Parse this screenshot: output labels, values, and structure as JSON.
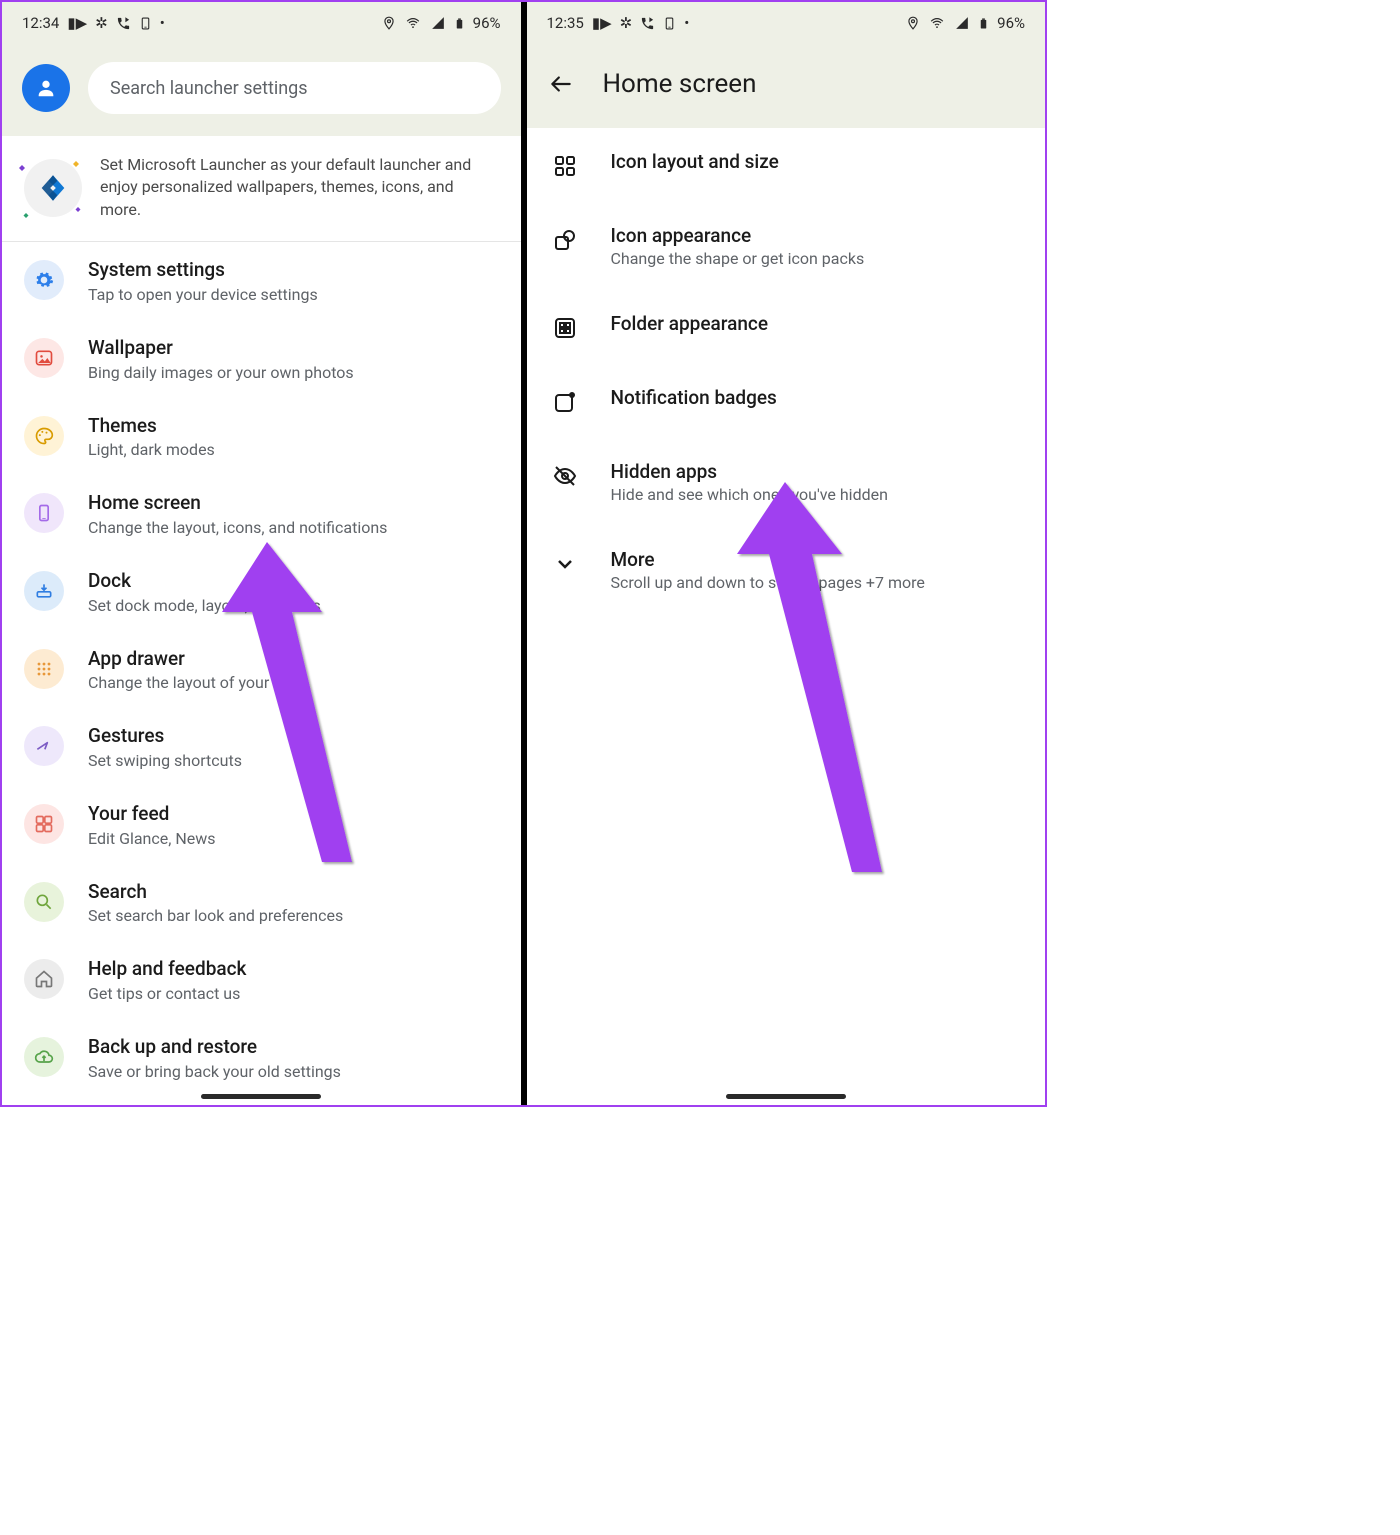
{
  "left": {
    "status": {
      "time": "12:34",
      "battery": "96%"
    },
    "search_placeholder": "Search launcher settings",
    "promo_text": "Set Microsoft Launcher as your default launcher and enjoy personalized wallpapers, themes, icons, and more.",
    "items": [
      {
        "title": "System settings",
        "sub": "Tap to open your device settings"
      },
      {
        "title": "Wallpaper",
        "sub": "Bing daily images or your own photos"
      },
      {
        "title": "Themes",
        "sub": "Light, dark modes"
      },
      {
        "title": "Home screen",
        "sub": "Change the layout, icons, and notifications"
      },
      {
        "title": "Dock",
        "sub": "Set dock mode, layout, and icons"
      },
      {
        "title": "App drawer",
        "sub": "Change the layout of your apps"
      },
      {
        "title": "Gestures",
        "sub": "Set swiping shortcuts"
      },
      {
        "title": "Your feed",
        "sub": "Edit Glance, News"
      },
      {
        "title": "Search",
        "sub": "Set search bar look and preferences"
      },
      {
        "title": "Help and feedback",
        "sub": "Get tips or contact us"
      },
      {
        "title": "Back up and restore",
        "sub": "Save or bring back your old settings"
      }
    ]
  },
  "right": {
    "status": {
      "time": "12:35",
      "battery": "96%"
    },
    "page_title": "Home screen",
    "items": [
      {
        "title": "Icon layout and size",
        "sub": ""
      },
      {
        "title": "Icon appearance",
        "sub": "Change the shape or get icon packs"
      },
      {
        "title": "Folder appearance",
        "sub": ""
      },
      {
        "title": "Notification badges",
        "sub": ""
      },
      {
        "title": "Hidden apps",
        "sub": "Hide and see which ones you've hidden"
      },
      {
        "title": "More",
        "sub": "Scroll up and down to switch pages +7 more"
      }
    ]
  }
}
